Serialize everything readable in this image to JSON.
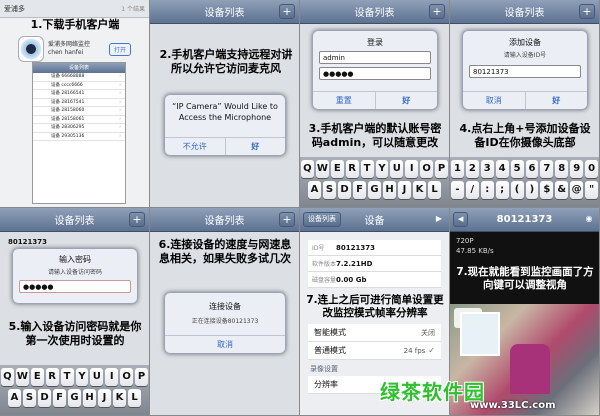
{
  "panel1": {
    "search_query": "爱浦多",
    "search_results": "1 个结果",
    "caption": "1.下载手机客户端",
    "app_name": "爱浦多网络监控",
    "app_author": "chen hanfei",
    "open_label": "打开",
    "list_title": "设备列表",
    "list_items": [
      "设备 66668888",
      "设备 cccc6666",
      "设备 28166541",
      "设备 28167541",
      "设备 28158060",
      "设备 28158061",
      "设备 28306295",
      "设备 29305136"
    ]
  },
  "panel2": {
    "title": "设备列表",
    "caption": "2.手机客户端支持远程对讲所以允许它访问麦克风",
    "dialog_title": "“IP Camera” Would Like to Access the Microphone",
    "deny_label": "不允许",
    "ok_label": "好"
  },
  "panel3": {
    "title": "设备列表",
    "dialog_title": "登录",
    "username": "admin",
    "password": "●●●●●",
    "reset_label": "重置",
    "ok_label": "好",
    "caption": "3.手机客户端的默认账号密码admin，可以随意更改"
  },
  "panel4": {
    "title": "设备列表",
    "dialog_title": "添加设备",
    "dialog_sub": "请输入设备ID号",
    "device_id": "80121373",
    "cancel_label": "取消",
    "ok_label": "好",
    "caption": "4.点右上角+号添加设备设备ID在你摄像头底部"
  },
  "keyboard": {
    "row1": [
      "Q",
      "W",
      "E",
      "R",
      "T",
      "Y",
      "U",
      "I",
      "O",
      "P"
    ],
    "row2": [
      "A",
      "S",
      "D",
      "F",
      "G",
      "H",
      "J",
      "K",
      "L"
    ],
    "numrow1": [
      "1",
      "2",
      "3",
      "4",
      "5",
      "6",
      "7",
      "8",
      "9",
      "0"
    ],
    "numrow2": [
      "-",
      "/",
      ":",
      ";",
      "(",
      ")",
      "$",
      "&",
      "@",
      "\""
    ]
  },
  "panel5": {
    "title": "设备列表",
    "device": "80121373",
    "dialog_title": "输入密码",
    "dialog_sub": "请输入设备访问密码",
    "password": "●●●●●",
    "caption": "5.输入设备访问密码就是你第一次使用时设置的"
  },
  "panel6": {
    "title": "设备列表",
    "caption": "6.连接设备的速度与网速息息相关，如果失败多试几次",
    "dialog_title": "连接设备",
    "dialog_sub": "正在连接设备80121373",
    "cancel_label": "取消"
  },
  "panel7": {
    "back_label": "设备列表",
    "title": "设备",
    "device_id_label": "ID号",
    "device_id": "80121373",
    "version_label": "软件版本",
    "version": "7.2.21HD",
    "disk_label": "磁盘容量",
    "disk": "0.00 Gb",
    "caption": "7.连上之后可进行简单设置更改监控模式帧率分辨率",
    "mode_smart": "智能模式",
    "mode_smart_value": "关闭",
    "mode_normal": "普通模式",
    "mode_normal_value": "24 fps",
    "section_record": "录像设置",
    "resolution": "分辨率"
  },
  "panel8": {
    "title": "80121373",
    "resolution": "720P",
    "speed": "47.85 KB/s",
    "time": "2013-09-18 15:40:11",
    "caption": "7.现在就能看到监控画面了方向键可以调整视角"
  },
  "watermark": {
    "brand": "绿茶软件园",
    "url": "www.33LC.com"
  }
}
